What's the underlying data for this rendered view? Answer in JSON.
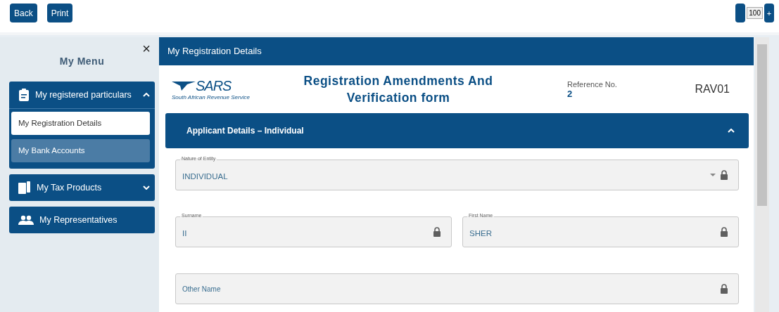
{
  "toolbar": {
    "buttons": [
      "Back",
      "Print"
    ],
    "zoom": {
      "value": "100",
      "plus": "+"
    }
  },
  "sidebar": {
    "title": "My Menu",
    "close": "×",
    "sections": [
      {
        "label": "My registered particulars",
        "expanded": true,
        "items": [
          {
            "label": "My Registration Details",
            "selected": true
          },
          {
            "label": "My Bank Accounts",
            "selected": false
          }
        ]
      },
      {
        "label": "My Tax Products",
        "expanded": false
      },
      {
        "label": "My Representatives"
      }
    ]
  },
  "panel": {
    "title": "My Registration Details",
    "logo": {
      "name": "SARS",
      "tagline": "South African Revenue Service"
    },
    "form_title": "Registration Amendments And Verification form",
    "reference": {
      "label": "Reference No.",
      "value": "2"
    },
    "form_code": "RAV01",
    "section": {
      "title": "Applicant Details – Individual",
      "expanded": true
    },
    "field_rows": [
      [
        {
          "kind": "select",
          "label": "Nature of Entity",
          "value": "INDIVIDUAL",
          "locked": true
        }
      ],
      [
        {
          "kind": "text",
          "label": "Surname",
          "value": "II",
          "locked": true
        },
        {
          "kind": "text",
          "label": "First Name",
          "value": "SHER",
          "locked": true
        }
      ],
      [
        {
          "kind": "text",
          "placeholder": "Other Name",
          "locked": true
        }
      ]
    ]
  }
}
